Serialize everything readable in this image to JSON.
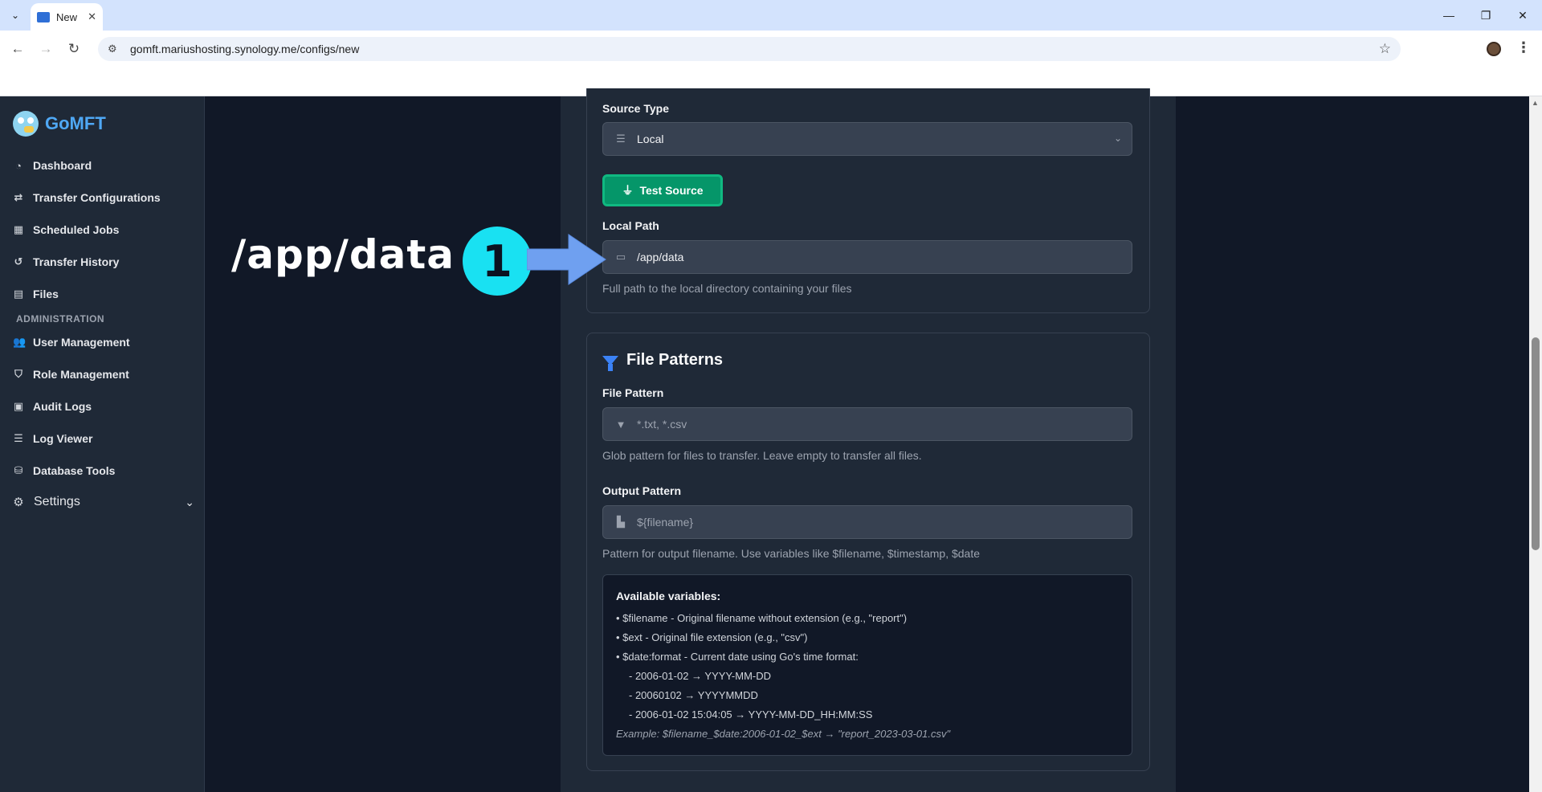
{
  "browser": {
    "tab_title": "New",
    "url": "gomft.mariushosting.synology.me/configs/new"
  },
  "app": {
    "name": "GoMFT"
  },
  "sidebar": {
    "items": [
      {
        "label": "Dashboard",
        "icon": "pie-chart-icon"
      },
      {
        "label": "Transfer Configurations",
        "icon": "exchange-icon"
      },
      {
        "label": "Scheduled Jobs",
        "icon": "calendar-icon"
      },
      {
        "label": "Transfer History",
        "icon": "history-icon"
      },
      {
        "label": "Files",
        "icon": "file-icon"
      }
    ],
    "section": "ADMINISTRATION",
    "admin_items": [
      {
        "label": "User Management",
        "icon": "users-icon"
      },
      {
        "label": "Role Management",
        "icon": "user-shield-icon"
      },
      {
        "label": "Audit Logs",
        "icon": "clipboard-icon"
      },
      {
        "label": "Log Viewer",
        "icon": "list-icon"
      },
      {
        "label": "Database Tools",
        "icon": "database-icon"
      }
    ],
    "settings": "Settings"
  },
  "source": {
    "type_label": "Source Type",
    "type_value": "Local",
    "test_button": "Test Source",
    "path_label": "Local Path",
    "path_value": "/app/data",
    "path_help": "Full path to the local directory containing your files"
  },
  "patterns": {
    "title": "File Patterns",
    "file_label": "File Pattern",
    "file_placeholder": "*.txt, *.csv",
    "file_help": "Glob pattern for files to transfer. Leave empty to transfer all files.",
    "output_label": "Output Pattern",
    "output_placeholder": "${filename}",
    "output_help": "Pattern for output filename. Use variables like $filename, $timestamp, $date"
  },
  "variables": {
    "title": "Available variables:",
    "lines": [
      "• $filename - Original filename without extension (e.g., \"report\")",
      "• $ext - Original file extension (e.g., \"csv\")",
      "• $date:format - Current date using Go's time format:"
    ],
    "sub_lines": [
      "- 2006-01-02 → YYYY-MM-DD",
      "- 20060102 → YYYYMMDD",
      "- 2006-01-02 15:04:05 → YYYY-MM-DD_HH:MM:SS"
    ],
    "example": "Example: $filename_$date:2006-01-02_$ext → \"report_2023-03-01.csv\""
  },
  "annotation": {
    "text": "/app/data",
    "step": "1"
  }
}
